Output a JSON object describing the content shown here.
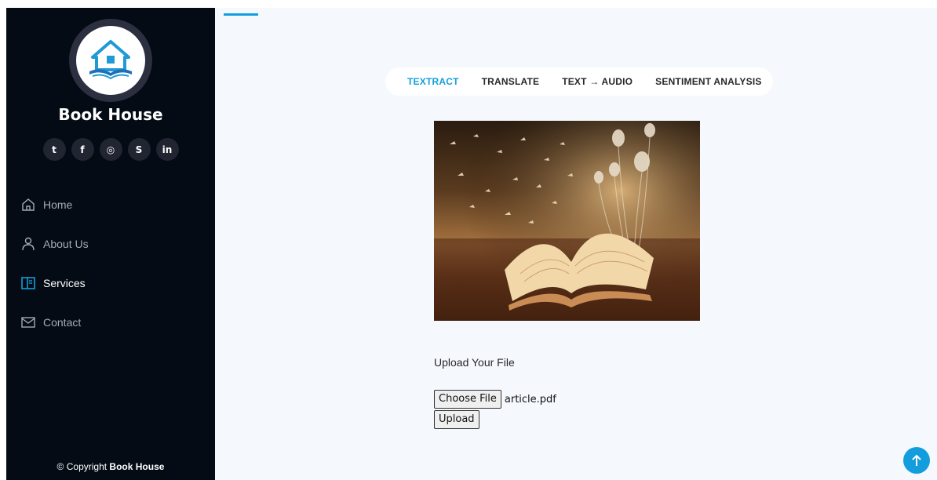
{
  "sidebar": {
    "brand": "Book House",
    "social": [
      {
        "icon": "twitter-icon",
        "glyph": "t"
      },
      {
        "icon": "facebook-icon",
        "glyph": "f"
      },
      {
        "icon": "instagram-icon",
        "glyph": "◎"
      },
      {
        "icon": "skype-icon",
        "glyph": "S"
      },
      {
        "icon": "linkedin-icon",
        "glyph": "in"
      }
    ],
    "nav": [
      {
        "label": "Home",
        "icon": "home-icon"
      },
      {
        "label": "About Us",
        "icon": "user-icon"
      },
      {
        "label": "Services",
        "icon": "layout-icon"
      },
      {
        "label": "Contact",
        "icon": "envelope-icon"
      }
    ],
    "copyright_prefix": "© Copyright ",
    "copyright_brand": "Book House"
  },
  "tabs": [
    "TEXTRACT",
    "TRANSLATE",
    "TEXT → AUDIO",
    "SENTIMENT ANALYSIS"
  ],
  "active_tab": "TEXTRACT",
  "upload": {
    "label": "Upload Your File",
    "choose_label": "Choose File",
    "file_name": "article.pdf",
    "upload_label": "Upload"
  },
  "colors": {
    "accent": "#149ddd",
    "sidebar_bg": "#040b14",
    "main_bg": "#f5f8fd"
  }
}
